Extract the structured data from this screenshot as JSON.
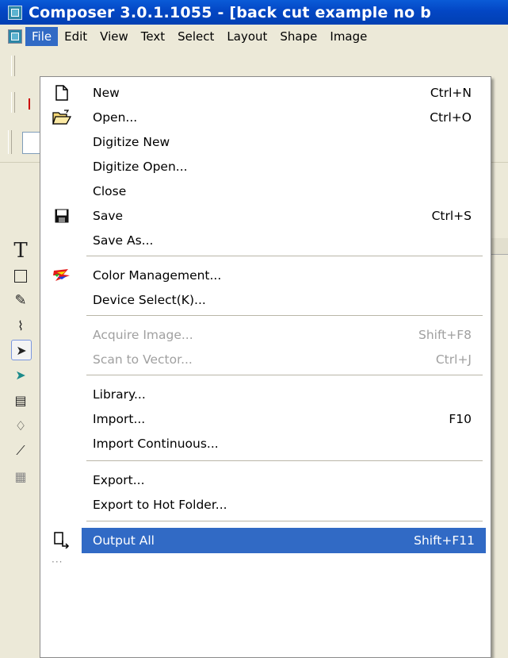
{
  "title": "Composer 3.0.1.1055 - [back cut example no b",
  "menubar": {
    "items": [
      "File",
      "Edit",
      "View",
      "Text",
      "Select",
      "Layout",
      "Shape",
      "Image"
    ]
  },
  "file_menu": {
    "new": {
      "label": "New",
      "shortcut": "Ctrl+N"
    },
    "open": {
      "label": "Open...",
      "shortcut": "Ctrl+O"
    },
    "digitize_new": {
      "label": "Digitize New"
    },
    "digitize_open": {
      "label": "Digitize Open..."
    },
    "close": {
      "label": "Close"
    },
    "save": {
      "label": "Save",
      "shortcut": "Ctrl+S"
    },
    "save_as": {
      "label": "Save As..."
    },
    "color_management": {
      "label": "Color Management..."
    },
    "device_select": {
      "label": "Device Select(K)..."
    },
    "acquire_image": {
      "label": "Acquire Image...",
      "shortcut": "Shift+F8"
    },
    "scan_to_vector": {
      "label": "Scan to Vector...",
      "shortcut": "Ctrl+J"
    },
    "library": {
      "label": "Library..."
    },
    "import": {
      "label": "Import...",
      "shortcut": "F10"
    },
    "import_continuous": {
      "label": "Import Continuous..."
    },
    "export": {
      "label": "Export..."
    },
    "export_hot_folder": {
      "label": "Export to Hot Folder..."
    },
    "output_all": {
      "label": "Output All",
      "shortcut": "Shift+F11"
    }
  },
  "colors": {
    "titlebar": "#0346c4",
    "highlight": "#316ac5",
    "menu_bg": "#ffffff",
    "chrome": "#ece9d8"
  },
  "icons": {
    "new": "new-document-icon",
    "open": "open-folder-icon",
    "save": "floppy-disk-icon",
    "color_management": "color-management-icon",
    "output_all": "output-icon"
  }
}
